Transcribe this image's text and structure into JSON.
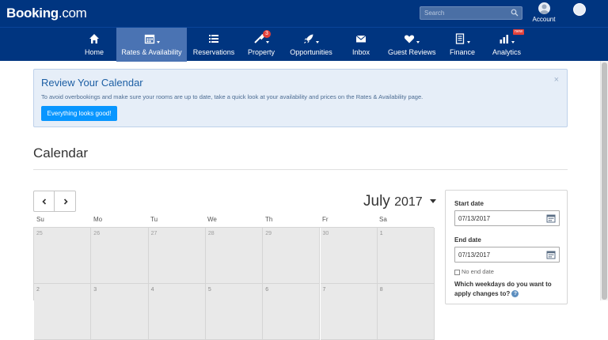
{
  "header": {
    "brand_name": "Booking",
    "brand_suffix": ".com",
    "search_placeholder": "Search",
    "account_label": "Account"
  },
  "nav": {
    "items": [
      {
        "label": "Home",
        "icon": "home-icon"
      },
      {
        "label": "Rates & Availability",
        "icon": "calendar-icon",
        "active": true
      },
      {
        "label": "Reservations",
        "icon": "list-icon"
      },
      {
        "label": "Property",
        "icon": "wrench-icon",
        "badge": "3"
      },
      {
        "label": "Opportunities",
        "icon": "rocket-icon"
      },
      {
        "label": "Inbox",
        "icon": "envelope-icon"
      },
      {
        "label": "Guest Reviews",
        "icon": "heart-icon"
      },
      {
        "label": "Finance",
        "icon": "document-icon"
      },
      {
        "label": "Analytics",
        "icon": "bar-chart-icon",
        "tag": "new"
      }
    ]
  },
  "alert": {
    "title": "Review Your Calendar",
    "close": "×",
    "text": "To avoid overbookings and make sure your rooms are up to date, take a quick look at your availability and prices on the Rates & Availability page.",
    "button_label": "Everything looks good!"
  },
  "page": {
    "title": "Calendar"
  },
  "calendar": {
    "month": "July",
    "year": "2017",
    "weekdays": [
      "Su",
      "Mo",
      "Tu",
      "We",
      "Th",
      "Fr",
      "Sa"
    ],
    "week_rows": [
      [
        "25",
        "26",
        "27",
        "28",
        "29",
        "30",
        "1"
      ],
      [
        "2",
        "3",
        "4",
        "5",
        "6",
        "7",
        "8"
      ]
    ]
  },
  "side_panel": {
    "start_label": "Start date",
    "start_value": "07/13/2017",
    "end_label": "End date",
    "end_value": "07/13/2017",
    "no_end_label": "No end date",
    "weekday_question": "Which weekdays do you want to apply changes to?",
    "help": "?"
  },
  "colors": {
    "brand_blue": "#003580",
    "active_tab": "#4a73b3",
    "alert_bg": "#e6eef8",
    "primary_button": "#0896ff",
    "badge_red": "#e2413a"
  }
}
